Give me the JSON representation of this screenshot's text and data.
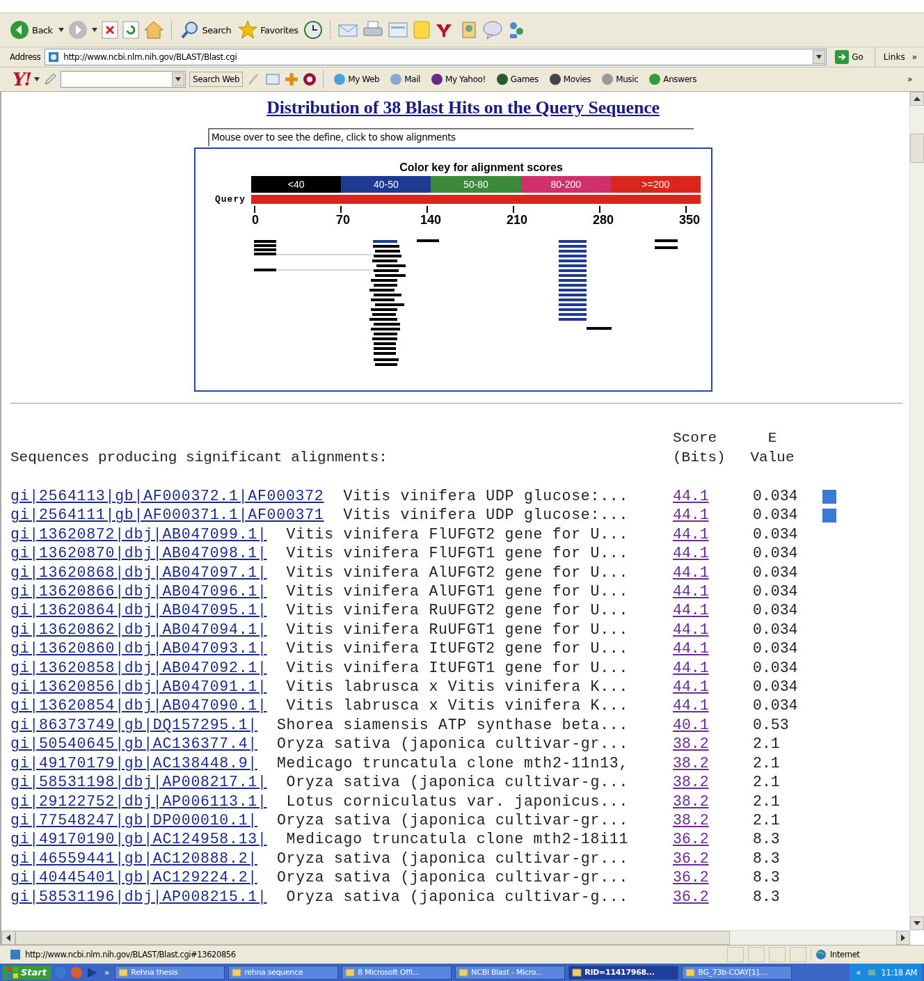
{
  "browser": {
    "back_label": "Back",
    "search_label": "Search",
    "favorites_label": "Favorites",
    "address_label": "Address",
    "url": "http://www.ncbi.nlm.nih.gov/BLAST/Blast.cgi",
    "go_label": "Go",
    "links_label": "Links",
    "links_more": "»"
  },
  "yahoo_bar": {
    "logo": "Y!",
    "search_button": "Search Web",
    "items": [
      "My Web",
      "Mail",
      "My Yahoo!",
      "Games",
      "Movies",
      "Music",
      "Answers"
    ],
    "more": "»"
  },
  "page": {
    "title": "Distribution of 38 Blast Hits on the Query Sequence",
    "define_box": "Mouse over to see the define, click to show alignments",
    "color_key": {
      "title": "Color key for alignment scores",
      "segments": [
        {
          "label": "<40",
          "color": "#000000"
        },
        {
          "label": "40-50",
          "color": "#1f3a93"
        },
        {
          "label": "50-80",
          "color": "#3a8a3a"
        },
        {
          "label": "80-200",
          "color": "#d0306a"
        },
        {
          "label": ">=200",
          "color": "#d8261c"
        }
      ],
      "query_label": "Query",
      "ticks": [
        "0",
        "70",
        "140",
        "210",
        "280",
        "350"
      ]
    },
    "table": {
      "heading": "Sequences producing significant alignments:",
      "score_header": [
        "Score",
        "(Bits)"
      ],
      "evalue_header": [
        "E",
        "Value"
      ],
      "rows": [
        {
          "id": "gi|2564113|gb|AF000372.1|AF000372",
          "description": "Vitis vinifera UDP glucose:...",
          "score": "44.1",
          "evalue": "0.034",
          "linkout": true
        },
        {
          "id": "gi|2564111|gb|AF000371.1|AF000371",
          "description": "Vitis vinifera UDP glucose:...",
          "score": "44.1",
          "evalue": "0.034",
          "linkout": true
        },
        {
          "id": "gi|13620872|dbj|AB047099.1|",
          "description": "Vitis vinifera FlUFGT2 gene for U...",
          "score": "44.1",
          "evalue": "0.034",
          "linkout": false
        },
        {
          "id": "gi|13620870|dbj|AB047098.1|",
          "description": "Vitis vinifera FlUFGT1 gene for U...",
          "score": "44.1",
          "evalue": "0.034",
          "linkout": false
        },
        {
          "id": "gi|13620868|dbj|AB047097.1|",
          "description": "Vitis vinifera AlUFGT2 gene for U...",
          "score": "44.1",
          "evalue": "0.034",
          "linkout": false
        },
        {
          "id": "gi|13620866|dbj|AB047096.1|",
          "description": "Vitis vinifera AlUFGT1 gene for U...",
          "score": "44.1",
          "evalue": "0.034",
          "linkout": false
        },
        {
          "id": "gi|13620864|dbj|AB047095.1|",
          "description": "Vitis vinifera RuUFGT2 gene for U...",
          "score": "44.1",
          "evalue": "0.034",
          "linkout": false
        },
        {
          "id": "gi|13620862|dbj|AB047094.1|",
          "description": "Vitis vinifera RuUFGT1 gene for U...",
          "score": "44.1",
          "evalue": "0.034",
          "linkout": false
        },
        {
          "id": "gi|13620860|dbj|AB047093.1|",
          "description": "Vitis vinifera ItUFGT2 gene for U...",
          "score": "44.1",
          "evalue": "0.034",
          "linkout": false
        },
        {
          "id": "gi|13620858|dbj|AB047092.1|",
          "description": "Vitis vinifera ItUFGT1 gene for U...",
          "score": "44.1",
          "evalue": "0.034",
          "linkout": false
        },
        {
          "id": "gi|13620856|dbj|AB047091.1|",
          "description": "Vitis labrusca x Vitis vinifera K...",
          "score": "44.1",
          "evalue": "0.034",
          "linkout": false
        },
        {
          "id": "gi|13620854|dbj|AB047090.1|",
          "description": "Vitis labrusca x Vitis vinifera K...",
          "score": "44.1",
          "evalue": "0.034",
          "linkout": false
        },
        {
          "id": "gi|86373749|gb|DQ157295.1|",
          "description": "Shorea siamensis ATP synthase beta...",
          "score": "40.1",
          "evalue": "0.53",
          "linkout": false
        },
        {
          "id": "gi|50540645|gb|AC136377.4|",
          "description": "Oryza sativa (japonica cultivar-gr...",
          "score": "38.2",
          "evalue": "2.1",
          "linkout": false
        },
        {
          "id": "gi|49170179|gb|AC138448.9|",
          "description": "Medicago truncatula clone mth2-11n13,",
          "score": "38.2",
          "evalue": "2.1",
          "linkout": false
        },
        {
          "id": "gi|58531198|dbj|AP008217.1|",
          "description": "Oryza sativa (japonica cultivar-g...",
          "score": "38.2",
          "evalue": "2.1",
          "linkout": false
        },
        {
          "id": "gi|29122752|dbj|AP006113.1|",
          "description": "Lotus corniculatus var. japonicus...",
          "score": "38.2",
          "evalue": "2.1",
          "linkout": false
        },
        {
          "id": "gi|77548247|gb|DP000010.1|",
          "description": "Oryza sativa (japonica cultivar-gr...",
          "score": "38.2",
          "evalue": "2.1",
          "linkout": false
        },
        {
          "id": "gi|49170190|gb|AC124958.13|",
          "description": "Medicago truncatula clone mth2-18i11",
          "score": "36.2",
          "evalue": "8.3",
          "linkout": false
        },
        {
          "id": "gi|46559441|gb|AC120888.2|",
          "description": "Oryza sativa (japonica cultivar-gr...",
          "score": "36.2",
          "evalue": "8.3",
          "linkout": false
        },
        {
          "id": "gi|40445401|gb|AC129224.2|",
          "description": "Oryza sativa (japonica cultivar-gr...",
          "score": "36.2",
          "evalue": "8.3",
          "linkout": false
        },
        {
          "id": "gi|58531196|dbj|AP008215.1|",
          "description": "Oryza sativa (japonica cultivar-g...",
          "score": "36.2",
          "evalue": "8.3",
          "linkout": false
        }
      ]
    }
  },
  "status_bar": {
    "url": "http://www.ncbi.nlm.nih.gov/BLAST/Blast.cgi#13620856",
    "zone": "Internet"
  },
  "taskbar": {
    "start": "Start",
    "more": "»",
    "tasks": [
      {
        "label": "Rehna thesis",
        "selected": false
      },
      {
        "label": "rehna sequence",
        "selected": false
      },
      {
        "label": "8 Microsoft Offi...",
        "selected": false
      },
      {
        "label": "NCBI Blast - Micro...",
        "selected": false
      },
      {
        "label": "RID=11417968...",
        "selected": true
      },
      {
        "label": "BG_73b-COAY[1]....",
        "selected": false
      }
    ],
    "tray_more": "«",
    "clock": "11:18 AM"
  }
}
